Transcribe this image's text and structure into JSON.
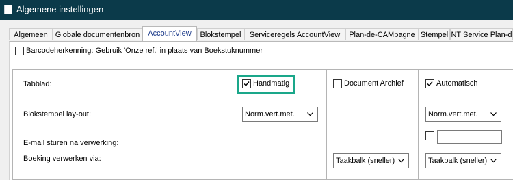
{
  "window": {
    "title": "Algemene instellingen",
    "app_icon": "document-icon"
  },
  "tabs": [
    {
      "label": "Algemeen"
    },
    {
      "label": "Globale documentenbron"
    },
    {
      "label": "AccountView",
      "active": true
    },
    {
      "label": "Blokstempel"
    },
    {
      "label": "Serviceregels AccountView"
    },
    {
      "label": "Plan-de-CAMpagne"
    },
    {
      "label": "Stempel"
    },
    {
      "label": "NT Service Plan-d"
    }
  ],
  "barcode": {
    "label": "Barcodeherkenning: Gebruik 'Onze ref.' in plaats van Boekstuknummer",
    "checked": false
  },
  "rows": {
    "tabblad": "Tabblad:",
    "blokstempel": "Blokstempel lay-out:",
    "email": "E-mail sturen na verwerking:",
    "boeking": "Boeking verwerken via:"
  },
  "columns": {
    "handmatig": {
      "label": "Handmatig",
      "checked": true,
      "layout_select": "Norm.vert.met."
    },
    "archief": {
      "label": "Document Archief",
      "checked": false,
      "boeking_select": "Taakbalk (sneller)"
    },
    "automatisch": {
      "label": "Automatisch",
      "checked": true,
      "layout_select": "Norm.vert.met.",
      "email_checked": false,
      "email_value": "",
      "boeking_select": "Taakbalk (sneller)"
    }
  },
  "colors": {
    "titlebar": "#0b3a4a",
    "highlight": "#1aa78a",
    "active_tab_text": "#1b3a8a"
  }
}
